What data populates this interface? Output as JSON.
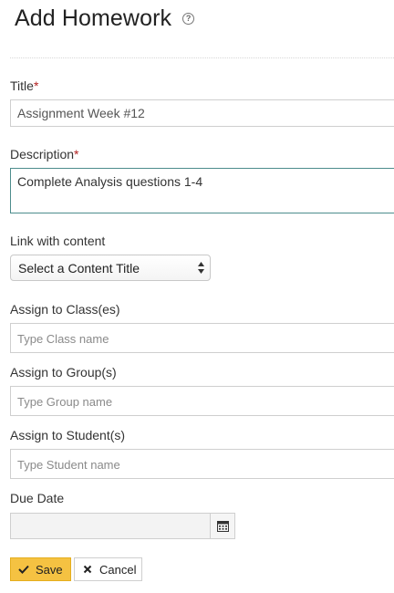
{
  "header": {
    "title": "Add Homework",
    "help_icon": "question-circle-icon"
  },
  "form": {
    "title": {
      "label": "Title",
      "required_mark": "*",
      "value": "Assignment Week #12"
    },
    "description": {
      "label": "Description",
      "required_mark": "*",
      "value": "Complete Analysis questions 1-4"
    },
    "content_link": {
      "label": "Link with content",
      "selected": "Select a Content Title"
    },
    "classes": {
      "label": "Assign to Class(es)",
      "placeholder": "Type Class name"
    },
    "groups": {
      "label": "Assign to Group(s)",
      "placeholder": "Type Group name"
    },
    "students": {
      "label": "Assign to Student(s)",
      "placeholder": "Type Student name"
    },
    "due_date": {
      "label": "Due Date",
      "value": "",
      "icon": "calendar-icon"
    }
  },
  "actions": {
    "save_label": "Save",
    "save_icon": "check-icon",
    "cancel_label": "Cancel",
    "cancel_icon": "close-icon"
  },
  "colors": {
    "save_bg": "#f5c242",
    "required": "#b22222",
    "focus_border": "#4d8c8c"
  }
}
